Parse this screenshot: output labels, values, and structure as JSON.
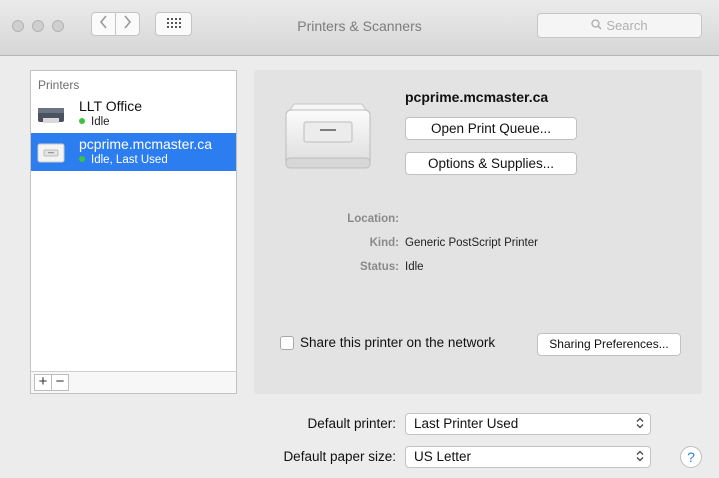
{
  "window": {
    "title": "Printers & Scanners"
  },
  "toolbar": {
    "back_icon": "chevron-left-icon",
    "forward_icon": "chevron-right-icon",
    "grid_icon": "grid-icon",
    "search_placeholder": "Search"
  },
  "sidebar": {
    "header": "Printers",
    "items": [
      {
        "name": "LLT Office",
        "status": "Idle",
        "status_color": "#3cc23c",
        "selected": false
      },
      {
        "name": "pcprime.mcmaster.ca",
        "status": "Idle, Last Used",
        "status_color": "#3cc23c",
        "selected": true
      }
    ],
    "add_label": "+",
    "remove_label": "−"
  },
  "details": {
    "printer_name": "pcprime.mcmaster.ca",
    "open_queue_label": "Open Print Queue...",
    "options_label": "Options & Supplies...",
    "location_label": "Location:",
    "location_value": "",
    "kind_label": "Kind:",
    "kind_value": "Generic PostScript Printer",
    "status_label": "Status:",
    "status_value": "Idle",
    "share_label": "Share this printer on the network",
    "share_checked": false,
    "sharing_prefs_label": "Sharing Preferences..."
  },
  "defaults": {
    "printer_label": "Default printer:",
    "printer_value": "Last Printer Used",
    "paper_label": "Default paper size:",
    "paper_value": "US Letter"
  },
  "help": {
    "label": "?"
  },
  "colors": {
    "accent": "#2c7ef0",
    "status_idle": "#3cc23c"
  }
}
